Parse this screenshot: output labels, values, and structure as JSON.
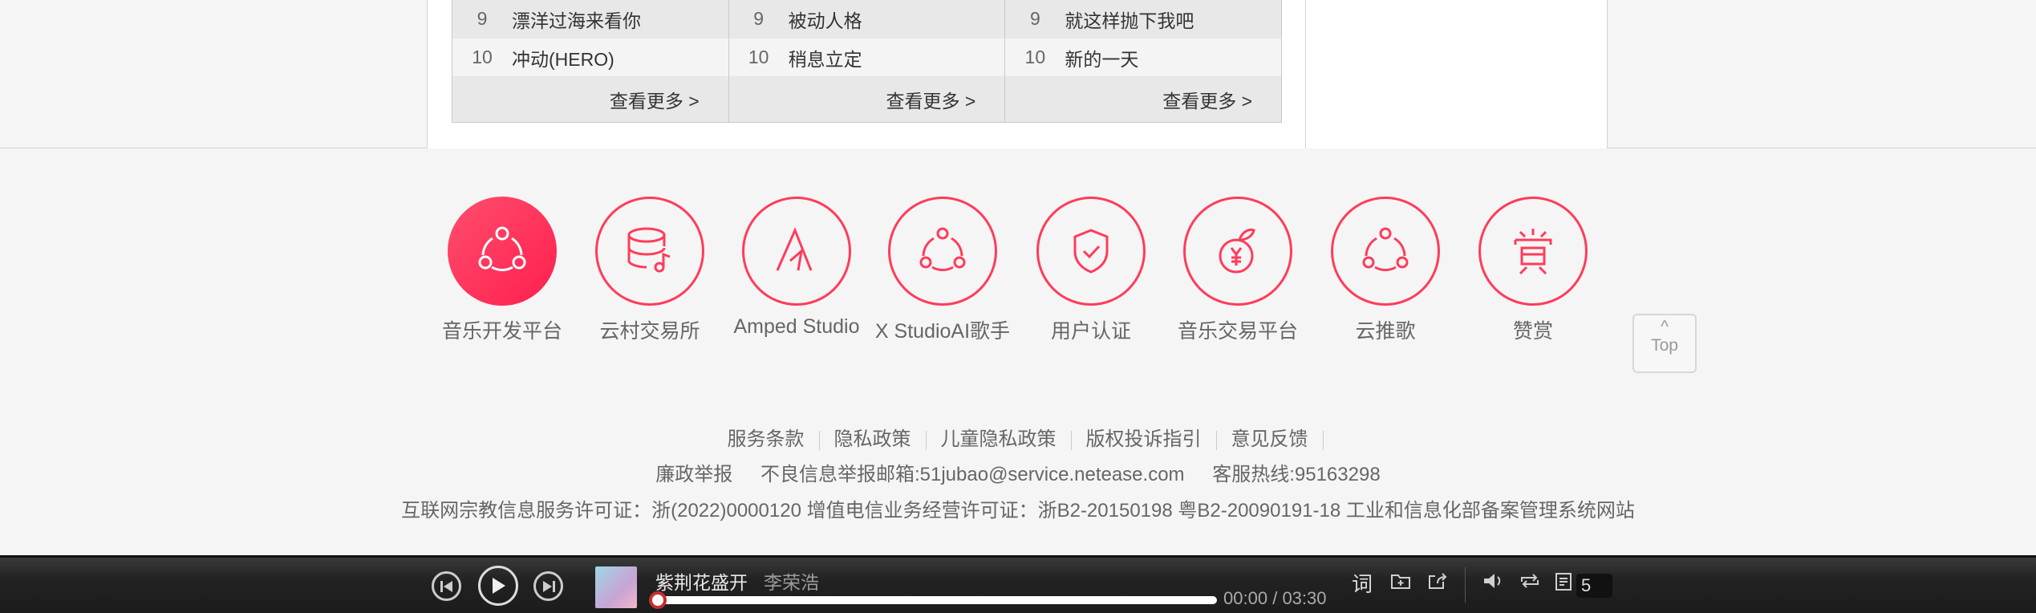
{
  "ranking": {
    "columns": [
      {
        "rows": [
          {
            "num": "9",
            "name": "漂洋过海来看你"
          },
          {
            "num": "10",
            "name": "冲动(HERO)"
          }
        ],
        "more": "查看更多 >"
      },
      {
        "rows": [
          {
            "num": "9",
            "name": "被动人格"
          },
          {
            "num": "10",
            "name": "稍息立定"
          }
        ],
        "more": "查看更多 >"
      },
      {
        "rows": [
          {
            "num": "9",
            "name": "就这样抛下我吧"
          },
          {
            "num": "10",
            "name": "新的一天"
          }
        ],
        "more": "查看更多 >"
      }
    ]
  },
  "services": [
    {
      "label": "音乐开发平台",
      "icon": "music-dev-platform-icon"
    },
    {
      "label": "云村交易所",
      "icon": "database-music-icon"
    },
    {
      "label": "Amped Studio",
      "icon": "amped-a-icon"
    },
    {
      "label": "X StudioAI歌手",
      "icon": "share-nodes-icon"
    },
    {
      "label": "用户认证",
      "icon": "shield-check-icon"
    },
    {
      "label": "音乐交易平台",
      "icon": "yen-fruit-icon"
    },
    {
      "label": "云推歌",
      "icon": "share-nodes-icon"
    },
    {
      "label": "赞赏",
      "icon": "reward-icon"
    }
  ],
  "top_button": {
    "caret": "^",
    "label": "Top"
  },
  "footer": {
    "links": [
      "服务条款",
      "隐私政策",
      "儿童隐私政策",
      "版权投诉指引",
      "意见反馈"
    ],
    "line2": [
      "廉政举报",
      "不良信息举报邮箱:51jubao@service.netease.com",
      "客服热线:95163298"
    ],
    "line3": "互联网宗教信息服务许可证：浙(2022)0000120 增值电信业务经营许可证：浙B2-20150198 粤B2-20090191-18 工业和信息化部备案管理系统网站"
  },
  "player": {
    "song_title": "紫荆花盛开",
    "artist": "李荣浩",
    "current_time": "00:00",
    "separator": "/",
    "total_time": "03:30",
    "lyric_label": "词",
    "playlist_count": "5",
    "progress": 0,
    "accent_color": "#c62f2f"
  },
  "colors": {
    "brand_red": "#ff3c5a"
  }
}
